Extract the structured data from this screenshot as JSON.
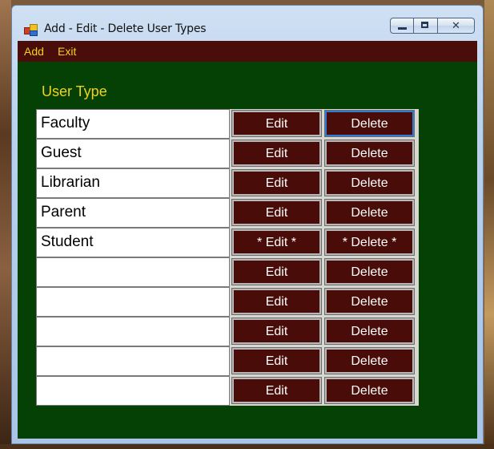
{
  "window": {
    "title": "Add - Edit - Delete User Types"
  },
  "menu": {
    "add": "Add",
    "exit": "Exit"
  },
  "section": {
    "label": "User Type"
  },
  "rows": [
    {
      "name": "Faculty",
      "edit": "Edit",
      "delete": "Delete"
    },
    {
      "name": "Guest",
      "edit": "Edit",
      "delete": "Delete"
    },
    {
      "name": "Librarian",
      "edit": "Edit",
      "delete": "Delete"
    },
    {
      "name": "Parent",
      "edit": "Edit",
      "delete": "Delete"
    },
    {
      "name": "Student",
      "edit": "* Edit *",
      "delete": "* Delete *"
    },
    {
      "name": "",
      "edit": "Edit",
      "delete": "Delete"
    },
    {
      "name": "",
      "edit": "Edit",
      "delete": "Delete"
    },
    {
      "name": "",
      "edit": "Edit",
      "delete": "Delete"
    },
    {
      "name": "",
      "edit": "Edit",
      "delete": "Delete"
    },
    {
      "name": "",
      "edit": "Edit",
      "delete": "Delete"
    }
  ],
  "colors": {
    "menubar": "#4a0d0a",
    "client": "#054005",
    "accent_text": "#f2d21a",
    "button": "#4a0c08"
  },
  "icons": {
    "app": "app-icon",
    "minimize": "minimize-icon",
    "maximize": "maximize-icon",
    "close": "close-icon"
  }
}
